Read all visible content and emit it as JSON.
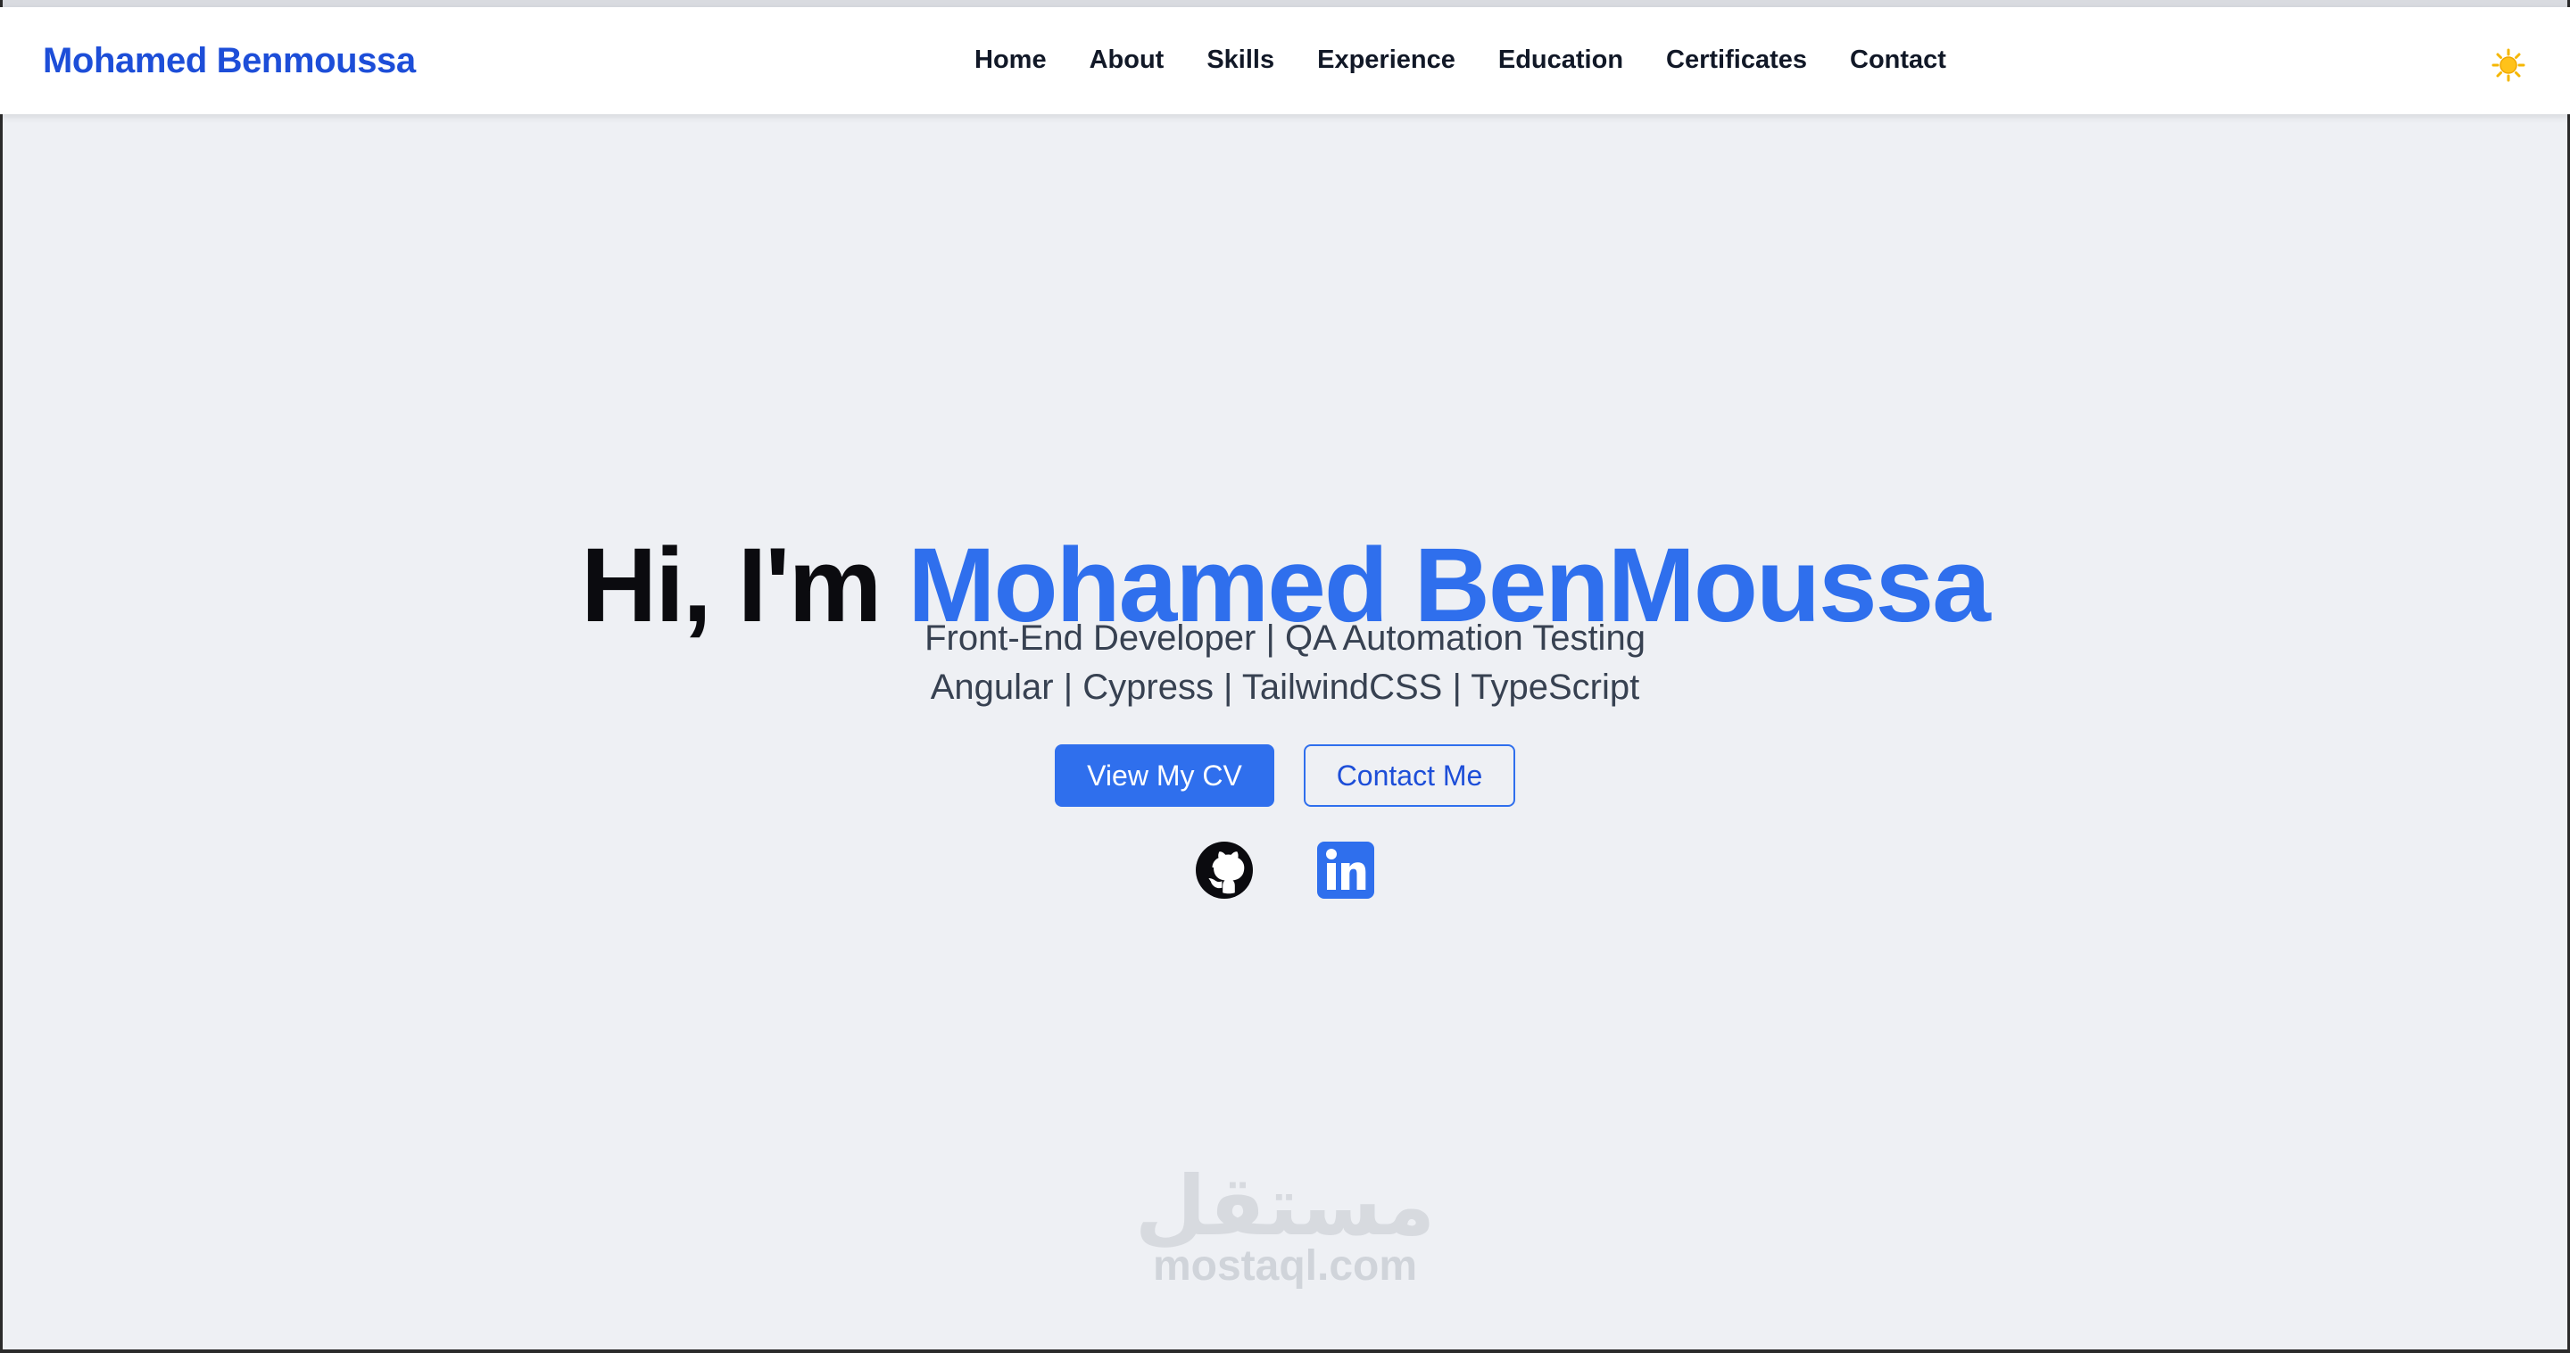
{
  "header": {
    "brand": "Mohamed Benmoussa",
    "nav_items": [
      {
        "label": "Home"
      },
      {
        "label": "About"
      },
      {
        "label": "Skills"
      },
      {
        "label": "Experience"
      },
      {
        "label": "Education"
      },
      {
        "label": "Certificates"
      },
      {
        "label": "Contact"
      }
    ],
    "theme_toggle": {
      "icon": "sun-icon",
      "color": "#f5b700"
    }
  },
  "hero": {
    "greeting": "Hi, I'm",
    "name": "Mohamed BenMoussa",
    "subtitle_line1": "Front-End Developer | QA Automation Testing",
    "subtitle_line2": "Angular | Cypress | TailwindCSS | TypeScript",
    "primary_button": "View My CV",
    "secondary_button": "Contact Me",
    "social_links": [
      {
        "icon": "github-icon"
      },
      {
        "icon": "linkedin-icon"
      }
    ]
  },
  "watermark": {
    "arabic": "مستقل",
    "domain": "mostaql.com"
  },
  "colors": {
    "brand": "#1d4ed8",
    "accent": "#2f6fed",
    "page_background": "#eef0f4",
    "heading": "#0b0b0f",
    "text": "#374151"
  }
}
